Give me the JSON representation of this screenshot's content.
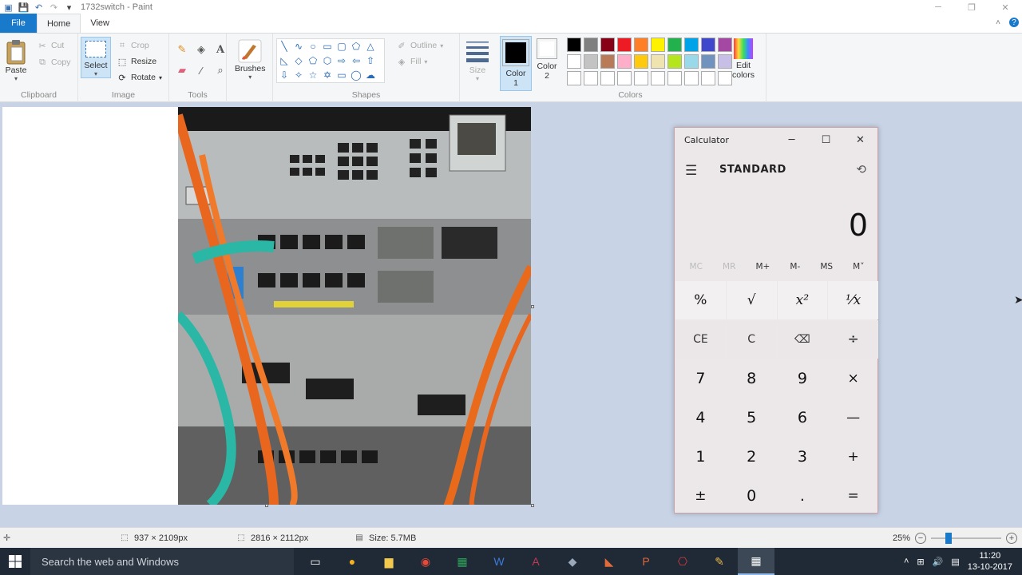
{
  "window": {
    "title": "1732switch - Paint",
    "quick_access": [
      "paint-app-icon",
      "save-icon",
      "undo-icon",
      "redo-icon",
      "customize-icon"
    ],
    "controls": [
      "minimize",
      "maximize",
      "close"
    ]
  },
  "ribbon_tabs": [
    {
      "label": "File"
    },
    {
      "label": "Home"
    },
    {
      "label": "View"
    }
  ],
  "ribbon": {
    "clipboard": {
      "label": "Clipboard",
      "paste": "Paste",
      "cut": "Cut",
      "copy": "Copy"
    },
    "image": {
      "label": "Image",
      "select": "Select",
      "crop": "Crop",
      "resize": "Resize",
      "rotate": "Rotate"
    },
    "tools": {
      "label": "Tools",
      "brushes": "Brushes",
      "icons": [
        "pencil-icon",
        "fill-icon",
        "text-icon",
        "eraser-icon",
        "color-picker-icon",
        "magnifier-icon"
      ]
    },
    "shapes": {
      "label": "Shapes",
      "outline": "Outline",
      "fill": "Fill"
    },
    "size": {
      "label": "Size"
    },
    "colors": {
      "label": "Colors",
      "color1": "Color 1",
      "color2": "Color 2",
      "color1_value": "#000000",
      "color2_value": "#ffffff",
      "edit_colors": "Edit colors",
      "palette": [
        "#000000",
        "#7f7f7f",
        "#880015",
        "#ed1c24",
        "#ff7f27",
        "#fff200",
        "#22b14c",
        "#00a2e8",
        "#3f48cc",
        "#a349a4",
        "#ffffff",
        "#c3c3c3",
        "#b97a57",
        "#ffaec9",
        "#ffc90e",
        "#efe4b0",
        "#b5e61d",
        "#99d9ea",
        "#7092be",
        "#c8bfe7",
        "#ffffff",
        "#ffffff",
        "#ffffff",
        "#ffffff",
        "#ffffff",
        "#ffffff",
        "#ffffff",
        "#ffffff",
        "#ffffff",
        "#ffffff"
      ]
    }
  },
  "calculator": {
    "title": "Calculator",
    "mode": "STANDARD",
    "display": "0",
    "memory": [
      {
        "label": "MC",
        "enabled": false
      },
      {
        "label": "MR",
        "enabled": false
      },
      {
        "label": "M+",
        "enabled": true
      },
      {
        "label": "M-",
        "enabled": true
      },
      {
        "label": "MS",
        "enabled": true
      },
      {
        "label": "M˅",
        "enabled": true
      }
    ],
    "keys": {
      "percent": "%",
      "sqrt": "√",
      "square": "x²",
      "reciprocal": "¹⁄x",
      "ce": "CE",
      "c": "C",
      "backspace": "⌫",
      "divide": "÷",
      "seven": "7",
      "eight": "8",
      "nine": "9",
      "multiply": "×",
      "four": "4",
      "five": "5",
      "six": "6",
      "minus": "—",
      "one": "1",
      "two": "2",
      "three": "3",
      "plus": "+",
      "negate": "±",
      "zero": "0",
      "decimal": ".",
      "equals": "="
    }
  },
  "statusbar": {
    "cursor_position": "937 × 2109px",
    "selection_size": "2816 × 2112px",
    "file_size": "Size: 5.7MB",
    "zoom": "25%",
    "zoom_level": 0.25
  },
  "taskbar": {
    "search_placeholder": "Search the web and Windows",
    "apps": [
      "task-view-icon",
      "app-icon",
      "file-explorer-icon",
      "chrome-icon",
      "excel-icon",
      "word-icon",
      "access-icon",
      "app-icon-2",
      "app-icon-3",
      "powerpoint-icon",
      "acrobat-icon",
      "paint-icon",
      "calculator-icon"
    ],
    "time": "11:20",
    "date": "13-10-2017"
  }
}
